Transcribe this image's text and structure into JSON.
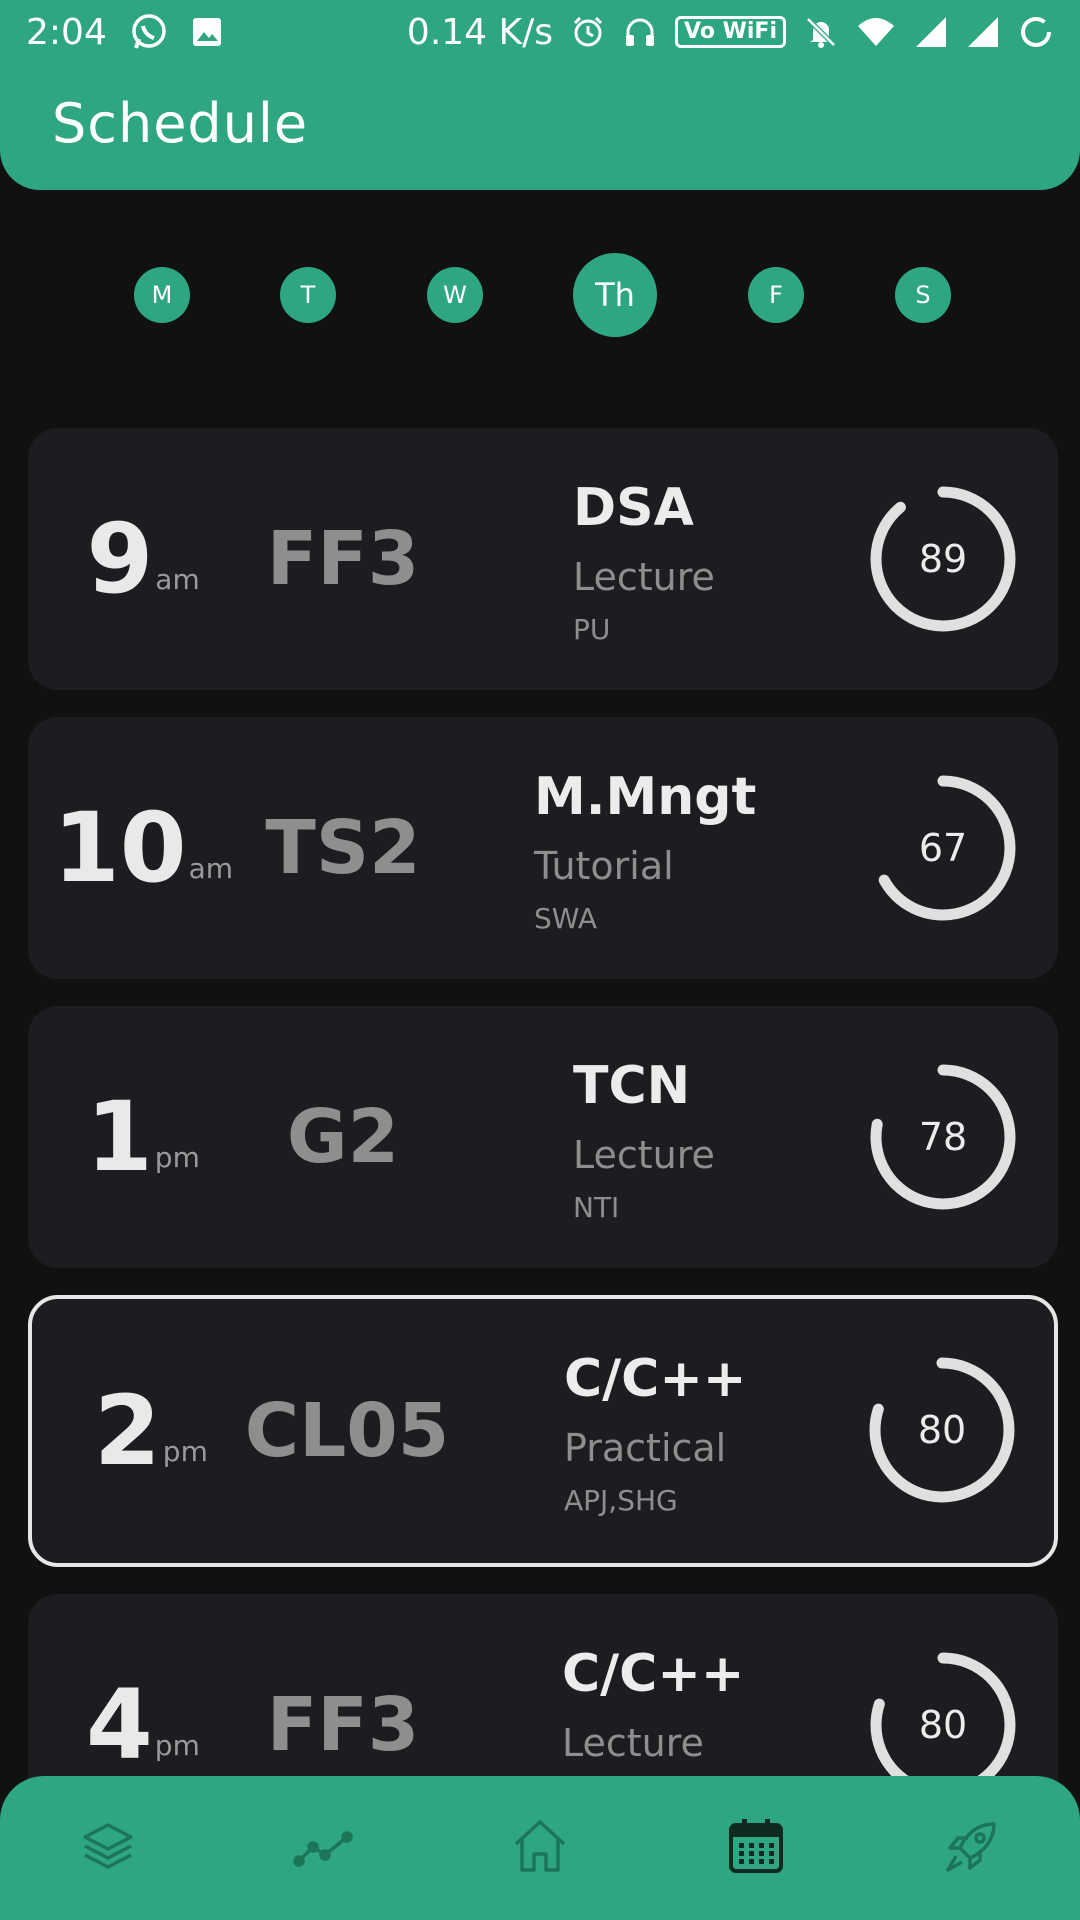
{
  "status_bar": {
    "time": "2:04",
    "net_speed": "0.14 K/s",
    "wifi_label": "Vo WiFi"
  },
  "header": {
    "title": "Schedule"
  },
  "days": [
    {
      "label": "M",
      "active": false
    },
    {
      "label": "T",
      "active": false
    },
    {
      "label": "W",
      "active": false
    },
    {
      "label": "Th",
      "active": true
    },
    {
      "label": "F",
      "active": false
    },
    {
      "label": "S",
      "active": false
    }
  ],
  "classes": [
    {
      "time": "9",
      "suffix": "am",
      "room": "FF3",
      "subject": "DSA",
      "type": "Lecture",
      "teacher": "PU",
      "attendance": 89,
      "selected": false
    },
    {
      "time": "10",
      "suffix": "am",
      "room": "TS2",
      "subject": "M.Mngt",
      "type": "Tutorial",
      "teacher": "SWA",
      "attendance": 67,
      "selected": false
    },
    {
      "time": "1",
      "suffix": "pm",
      "room": "G2",
      "subject": "TCN",
      "type": "Lecture",
      "teacher": "NTI",
      "attendance": 78,
      "selected": false
    },
    {
      "time": "2",
      "suffix": "pm",
      "room": "CL05",
      "subject": "C/C++",
      "type": "Practical",
      "teacher": "APJ,SHG",
      "attendance": 80,
      "selected": true
    },
    {
      "time": "4",
      "suffix": "pm",
      "room": "FF3",
      "subject": "C/C++",
      "type": "Lecture",
      "teacher": "",
      "attendance": 80,
      "selected": false
    }
  ],
  "bottom_nav": [
    {
      "icon": "layers-icon",
      "active": false
    },
    {
      "icon": "trend-chart-icon",
      "active": false
    },
    {
      "icon": "home-icon",
      "active": false
    },
    {
      "icon": "calendar-icon",
      "active": true
    },
    {
      "icon": "rocket-icon",
      "active": false
    }
  ],
  "colors": {
    "accent": "#2ea682",
    "background": "#111112",
    "card": "#1c1d20",
    "nav_icon": "#1d7559",
    "nav_icon_active": "#102a22"
  }
}
